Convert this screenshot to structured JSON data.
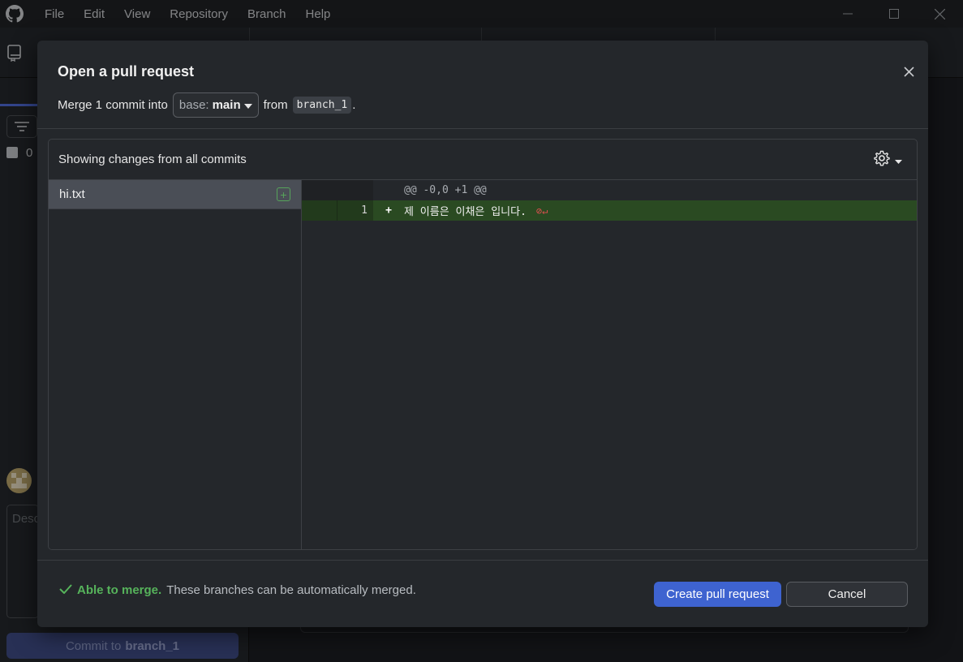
{
  "menu": {
    "items": [
      "File",
      "Edit",
      "View",
      "Repository",
      "Branch",
      "Help"
    ]
  },
  "background": {
    "changes_count": "0",
    "description_placeholder": "Desc",
    "commit_button": {
      "prefix": "Commit to",
      "branch": "branch_1"
    }
  },
  "dialog": {
    "title": "Open a pull request",
    "subtitle_prefix": "Merge 1 commit into",
    "base_label": "base:",
    "base_value": "main",
    "from_label": "from",
    "head_branch": "branch_1",
    "suffix": "."
  },
  "changes": {
    "header": "Showing changes from all commits",
    "files": [
      {
        "name": "hi.txt",
        "status": "added"
      }
    ],
    "diff": {
      "hunk_header": "@@ -0,0 +1 @@",
      "lines": [
        {
          "old": "",
          "new": "1",
          "sign": "+",
          "text": "제 이름은 이채은 입니다."
        }
      ],
      "no_newline_marker": "⊘↵"
    }
  },
  "footer": {
    "status_title": "Able to merge.",
    "status_desc": "These branches can be automatically merged.",
    "create_button": "Create pull request",
    "cancel_button": "Cancel"
  },
  "colors": {
    "accent": "#3e63d0",
    "success": "#56b35b",
    "added_line_bg": "#2a4a22"
  }
}
